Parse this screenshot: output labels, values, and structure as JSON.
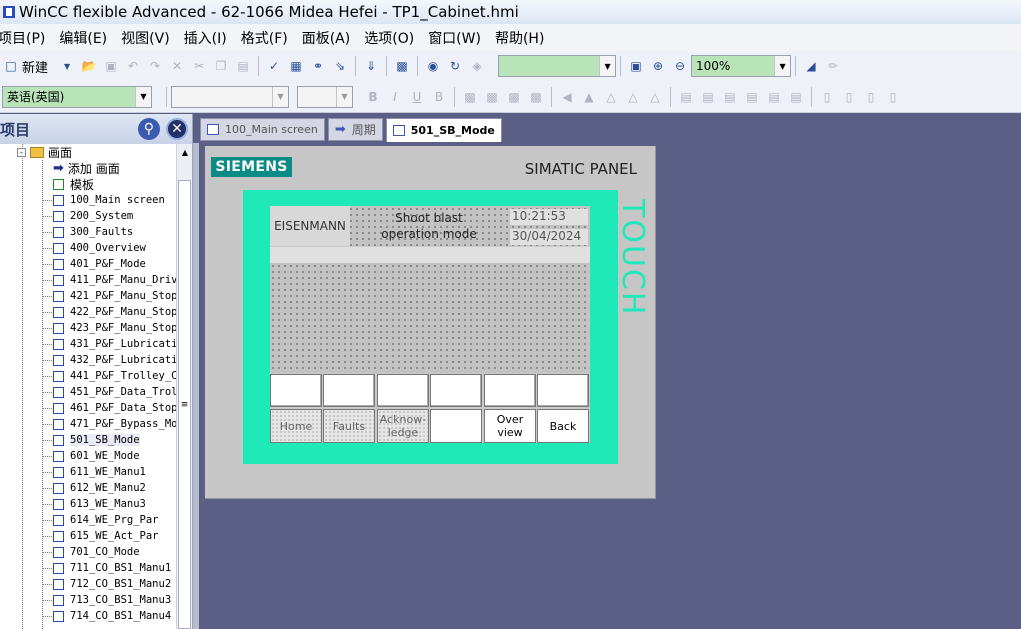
{
  "window": {
    "title": "WinCC flexible Advanced - 62-1066 Midea Hefei - TP1_Cabinet.hmi"
  },
  "menu": [
    "项目(P)",
    "编辑(E)",
    "视图(V)",
    "插入(I)",
    "格式(F)",
    "面板(A)",
    "选项(O)",
    "窗口(W)",
    "帮助(H)"
  ],
  "toolbar": {
    "new_label": "新建",
    "zoom_value": "100%",
    "language_value": "英语(英国)"
  },
  "project_panel": {
    "title": "项目",
    "folder": "画面",
    "add_screen": "添加 画面",
    "template": "模板",
    "screens": [
      "100_Main screen",
      "200_System",
      "300_Faults",
      "400_Overview",
      "401_P&F_Mode",
      "411_P&F_Manu_Driv",
      "421_P&F_Manu_Stop",
      "422_P&F_Manu_Stop",
      "423_P&F_Manu_Stop",
      "431_P&F_Lubricati",
      "432_P&F_Lubricati",
      "441_P&F_Trolley_C",
      "451_P&F_Data_Trol",
      "461_P&F_Data_Stop",
      "471_P&F_Bypass_Mo",
      "501_SB_Mode",
      "601_WE_Mode",
      "611_WE_Manu1",
      "612_WE_Manu2",
      "613_WE_Manu3",
      "614_WE_Prg_Par",
      "615_WE_Act_Par",
      "701_CO_Mode",
      "711_CO_BS1_Manu1",
      "712_CO_BS1_Manu2",
      "713_CO_BS1_Manu3",
      "714_CO_BS1_Manu4"
    ]
  },
  "tabs": [
    {
      "label": "100_Main screen",
      "active": false
    },
    {
      "label": "周期",
      "active": false
    },
    {
      "label": "501_SB_Mode",
      "active": true
    }
  ],
  "hmi": {
    "brand": "SIEMENS",
    "panel_name": "SIMATIC PANEL",
    "touch_label": "TOUCH",
    "company": "EISENMANN",
    "mode_line1": "Shoot blast",
    "mode_line2": "operation mode",
    "time": "10:21:53",
    "date": "30/04/2024",
    "fkeys_bottom": [
      "Home",
      "Faults",
      "Acknow-\nledge",
      "",
      "Over\nview",
      "Back"
    ]
  },
  "colors": {
    "accent": "#1fe8b9",
    "siemens": "#0a8b85",
    "workspace": "#5c5f85"
  }
}
